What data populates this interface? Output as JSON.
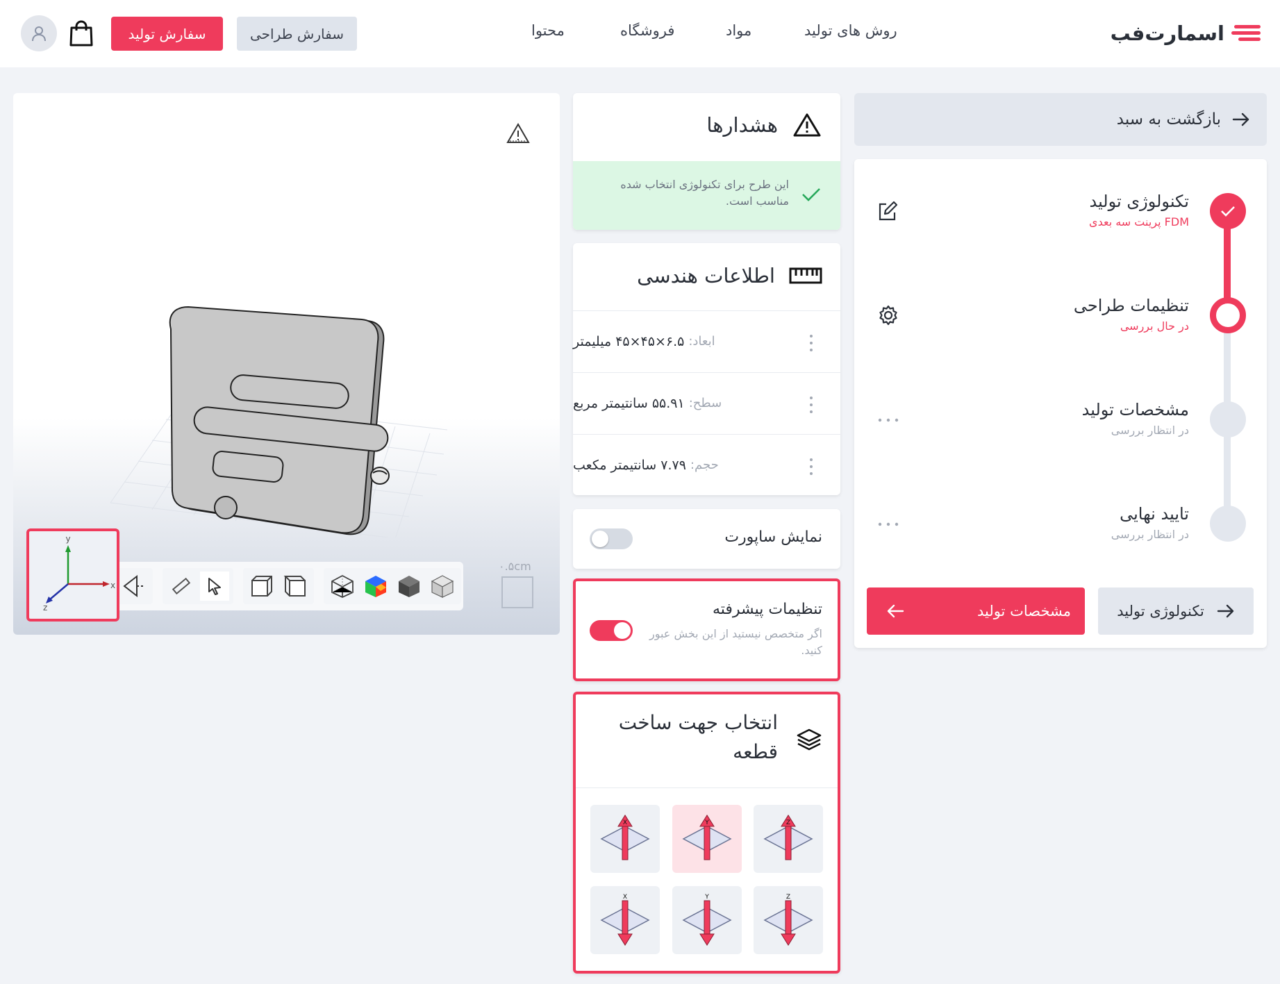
{
  "header": {
    "logo_text": "اسمارت‌فب",
    "nav": [
      "روش های تولید",
      "مواد",
      "فروشگاه",
      "محتوا"
    ],
    "design_order_label": "سفارش طراحی",
    "production_order_label": "سفارش تولید",
    "cart_icon": "shopping-bag-icon",
    "user_icon": "user-icon"
  },
  "sidebar": {
    "back_label": "بازگشت به سبد",
    "steps": [
      {
        "title": "تکنولوژی تولید",
        "subtitle": "پرینت سه بعدی FDM",
        "state": "done",
        "action_icon": "edit-icon"
      },
      {
        "title": "تنظیمات طراحی",
        "subtitle": "در حال بررسی",
        "state": "active",
        "action_icon": "gear-icon"
      },
      {
        "title": "مشخصات تولید",
        "subtitle": "در انتظار بررسی",
        "state": "pending",
        "action_icon": "more-dots-icon"
      },
      {
        "title": "تایید نهایی",
        "subtitle": "در انتظار بررسی",
        "state": "pending",
        "action_icon": "more-dots-icon"
      }
    ],
    "next_button_label": "مشخصات تولید",
    "prev_button_label": "تکنولوژی تولید"
  },
  "warnings": {
    "title": "هشدارها",
    "message": "این طرح برای تکنولوژی انتخاب شده مناسب است."
  },
  "geometry": {
    "title": "اطلاعات هندسی",
    "rows": [
      {
        "label": "ابعاد:",
        "value": "۶.۵×۴۵×۴۵ میلیمتر"
      },
      {
        "label": "سطح:",
        "value": "۵۵.۹۱ سانتیمتر مربع"
      },
      {
        "label": "حجم:",
        "value": "۷.۷۹ سانتیمتر مکعب"
      }
    ]
  },
  "support": {
    "label": "نمایش ساپورت",
    "on": false
  },
  "advanced": {
    "title": "تنظیمات پیشرفته",
    "hint": "اگر متخصص نیستید از این بخش عبور کنید.",
    "on": true
  },
  "orientation": {
    "title": "انتخاب جهت ساخت قطعه",
    "selected": "Y-up",
    "options": [
      "Z-up",
      "Y-up",
      "X-up",
      "Z-down",
      "Y-down",
      "X-down"
    ]
  },
  "viewer": {
    "scale_label": "۰.۵cm",
    "axes": {
      "x": "x",
      "y": "y",
      "z": "z"
    }
  },
  "colors": {
    "accent": "#ef3b5c",
    "success_bg": "#dcf7e4",
    "muted": "#a2a8b3"
  }
}
